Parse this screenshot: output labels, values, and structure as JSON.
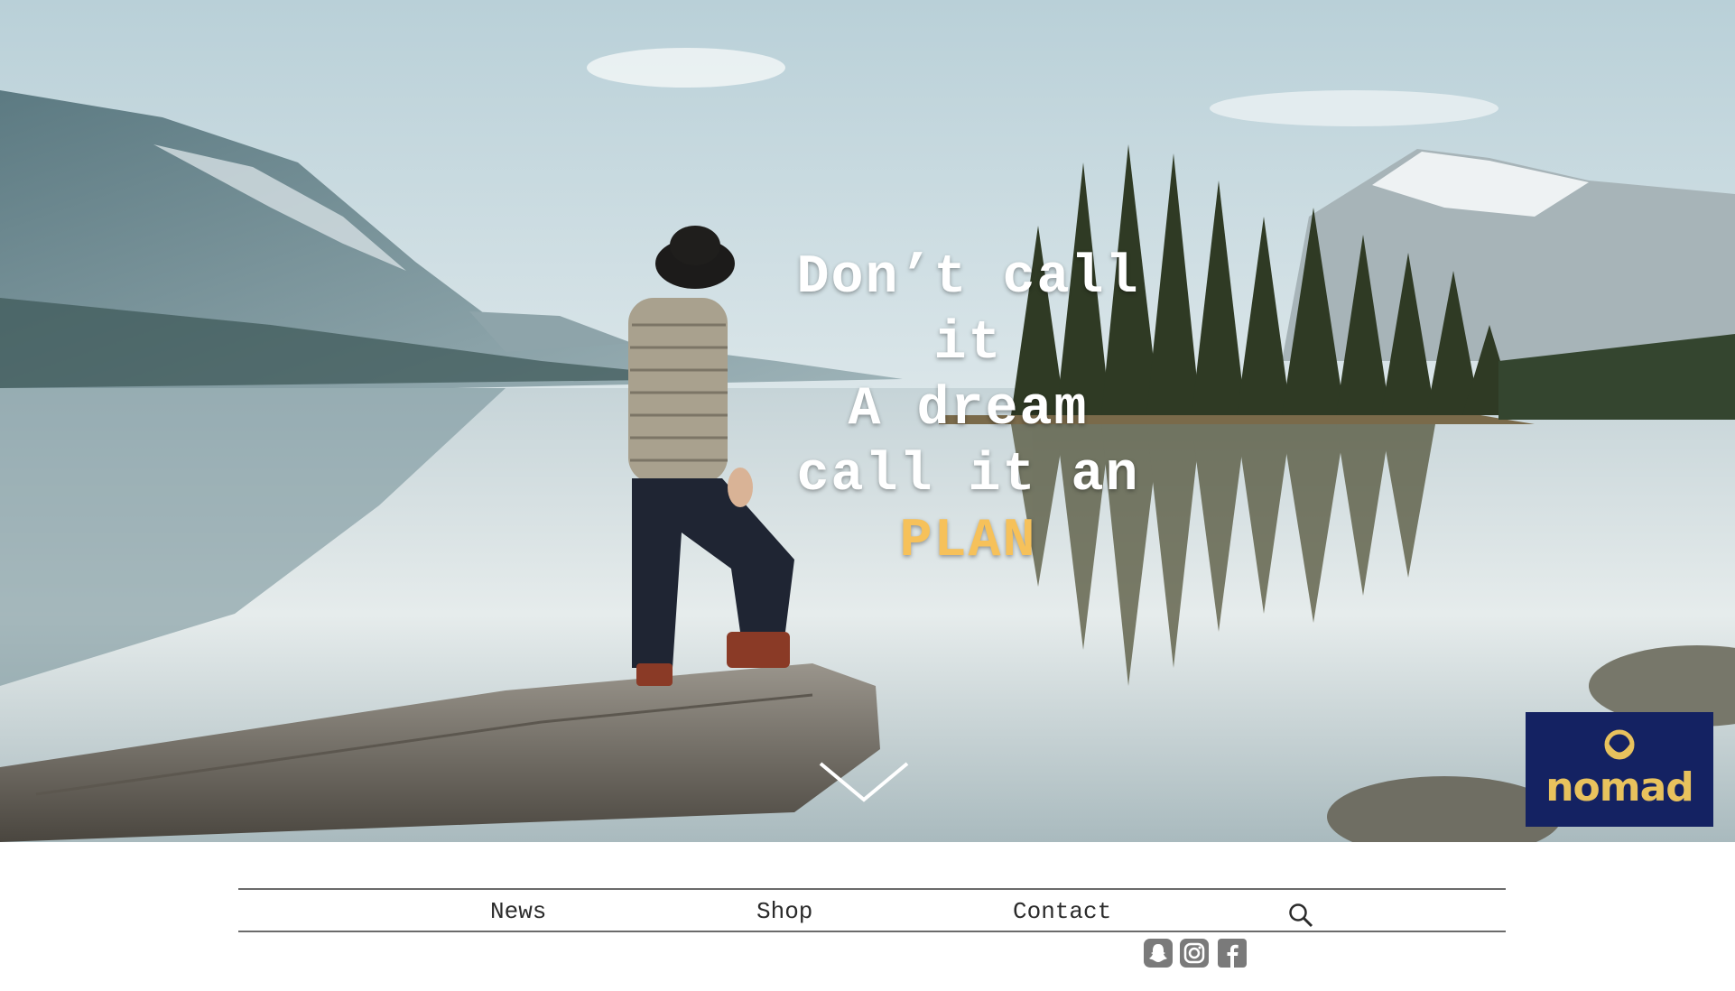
{
  "hero": {
    "headline": {
      "line1": "Don’t call",
      "line2": "it",
      "line3": "A dream",
      "line4": "call it an",
      "highlight": "PLAN"
    },
    "highlight_color": "#f6c15a",
    "scroll_icon": "chevron-down-icon"
  },
  "brand": {
    "logo_text": "nomad",
    "logo_bg": "#142262",
    "logo_color": "#e8c25d"
  },
  "nav": {
    "items": [
      {
        "label": "News"
      },
      {
        "label": "Shop"
      },
      {
        "label": "Contact"
      }
    ],
    "search_icon": "search-icon"
  },
  "social": [
    {
      "icon": "snapchat-icon"
    },
    {
      "icon": "instagram-icon"
    },
    {
      "icon": "facebook-icon"
    }
  ]
}
